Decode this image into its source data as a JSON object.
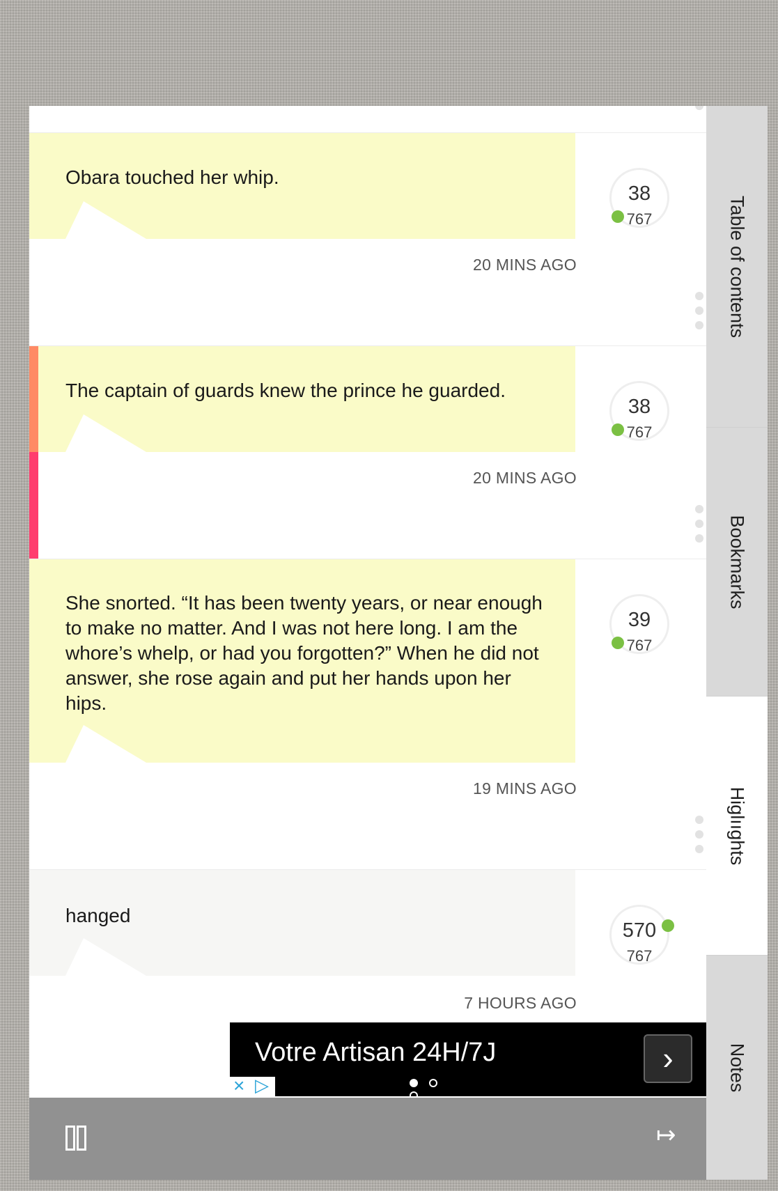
{
  "tabs": [
    {
      "label": "Table of contents",
      "active": false
    },
    {
      "label": "Bookmarks",
      "active": false
    },
    {
      "label": "Higlııghts",
      "active": true
    },
    {
      "label": "Notes",
      "active": false
    }
  ],
  "highlights": [
    {
      "text": "Obara touched her whip.",
      "time": "20 MINS AGO",
      "position": "38",
      "total": "767"
    },
    {
      "text": "The captain of guards knew the prince he guarded.",
      "time": "20 MINS AGO",
      "position": "38",
      "total": "767"
    },
    {
      "text": "She snorted. “It has been twenty years, or near enough to make no matter. And I was not here long. I am the whore’s whelp, or had you forgotten?” When he did not answer, she rose again and put her hands upon her hips.",
      "time": "19 MINS AGO",
      "position": "39",
      "total": "767"
    },
    {
      "text": "hanged",
      "time": "7 HOURS AGO",
      "position": "570",
      "total": "767"
    }
  ],
  "ad": {
    "headline": "Votre Artisan 24H/7J",
    "next_icon": "chevron-right-icon",
    "close_icon": "close-icon",
    "adchoices_icon": "adchoices-icon"
  },
  "bottom_bar": {
    "pages_icon": "two-page-icon",
    "exit_icon": "exit-arrow-icon"
  },
  "colors": {
    "highlight_bg": "#fafbc8",
    "position_dot": "#7bc043",
    "stripe_orange": "#ff8a65",
    "stripe_pink": "#ff3d6e",
    "bottom_bar": "#919191",
    "tab_bg": "#d9d9d9"
  }
}
